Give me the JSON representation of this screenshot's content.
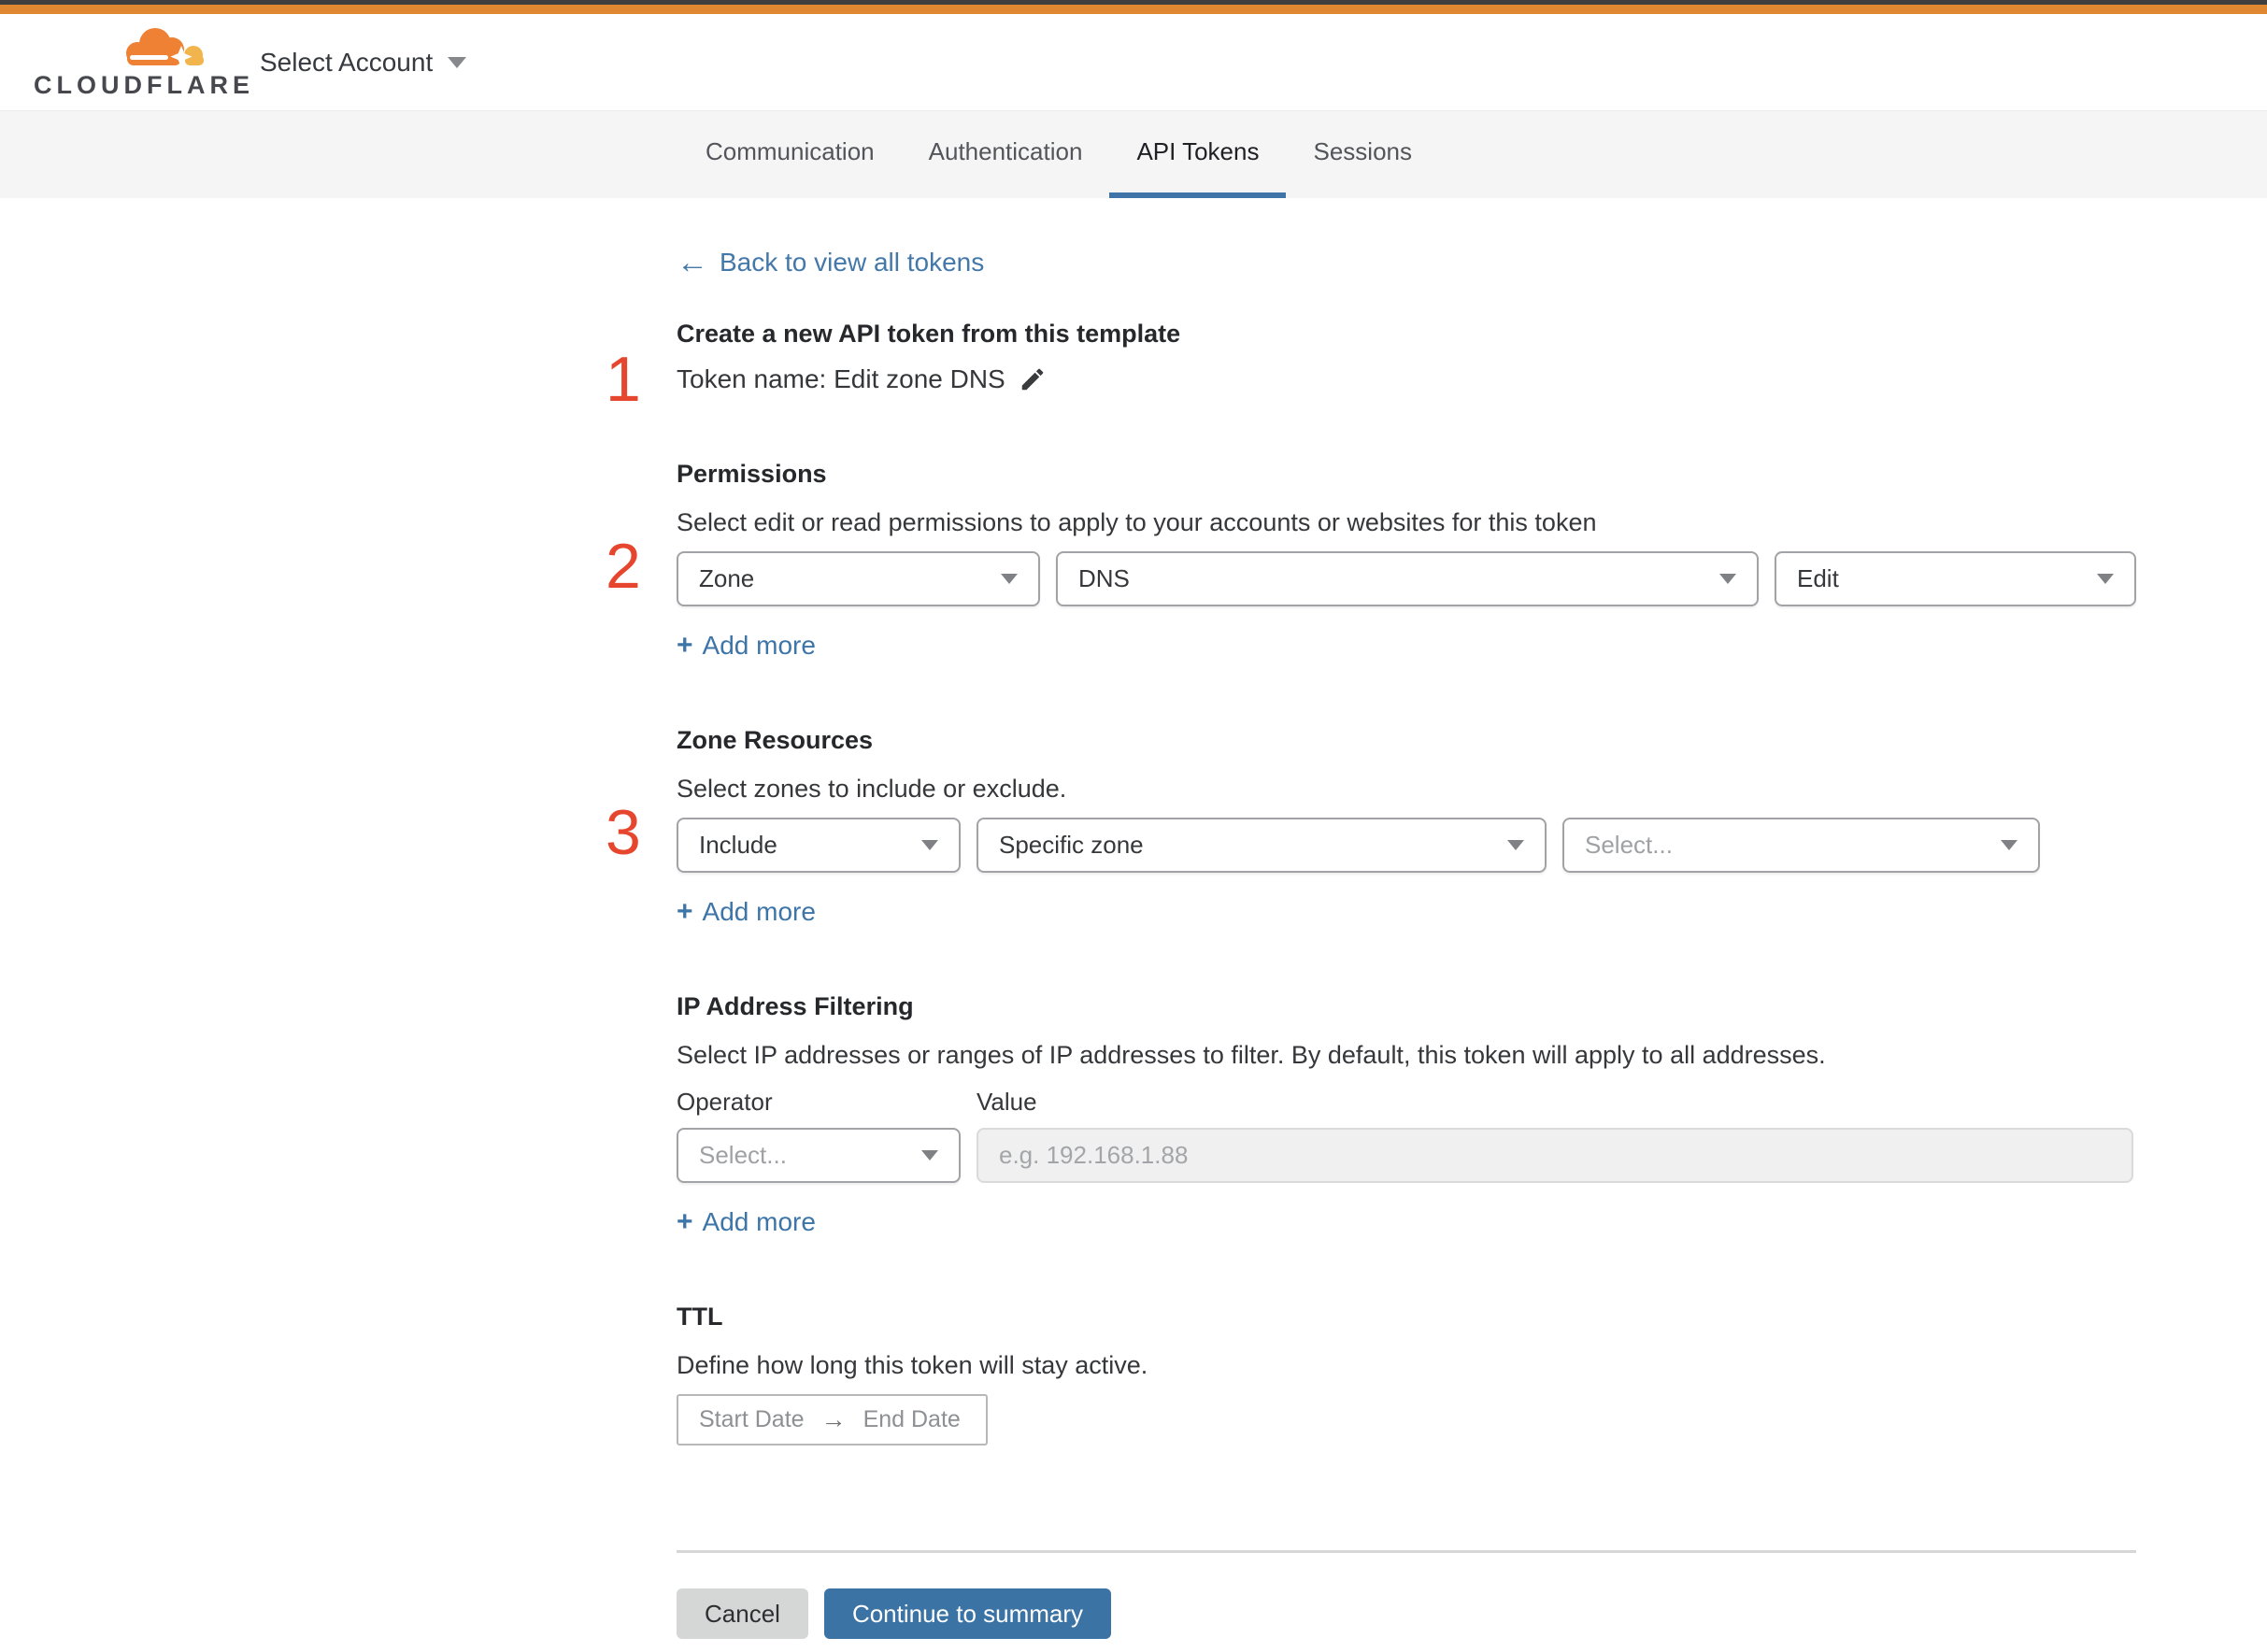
{
  "header": {
    "logo_text": "CLOUDFLARE",
    "account_selector_label": "Select Account"
  },
  "tabs": [
    {
      "label": "Communication"
    },
    {
      "label": "Authentication"
    },
    {
      "label": "API Tokens"
    },
    {
      "label": "Sessions"
    }
  ],
  "active_tab": "API Tokens",
  "back_link_label": "Back to view all tokens",
  "step1": {
    "number": "1",
    "title": "Create a new API token from this template",
    "token_name": "Token name: Edit zone DNS"
  },
  "step2": {
    "number": "2",
    "title": "Permissions",
    "description": "Select edit or read permissions to apply to your accounts or websites for this token",
    "select1": "Zone",
    "select2": "DNS",
    "select3": "Edit",
    "add_more": "Add more"
  },
  "step3": {
    "number": "3",
    "title": "Zone Resources",
    "description": "Select zones to include or exclude.",
    "select1": "Include",
    "select2": "Specific zone",
    "select3": "Select...",
    "add_more": "Add more"
  },
  "ip_filtering": {
    "title": "IP Address Filtering",
    "description": "Select IP addresses or ranges of IP addresses to filter. By default, this token will apply to all addresses.",
    "operator_label": "Operator",
    "value_label": "Value",
    "operator_select": "Select...",
    "value_placeholder": "e.g. 192.168.1.88",
    "add_more": "Add more"
  },
  "ttl": {
    "title": "TTL",
    "description": "Define how long this token will stay active.",
    "start_date": "Start Date",
    "end_date": "End Date"
  },
  "footer": {
    "cancel_label": "Cancel",
    "continue_label": "Continue to summary"
  },
  "colors": {
    "top_bar_orange": "#e08732",
    "link_blue": "#3d75a8",
    "active_tab_underline": "#3e74a8",
    "step_number_red": "#e7462e",
    "primary_button_blue": "#3c73a5"
  }
}
